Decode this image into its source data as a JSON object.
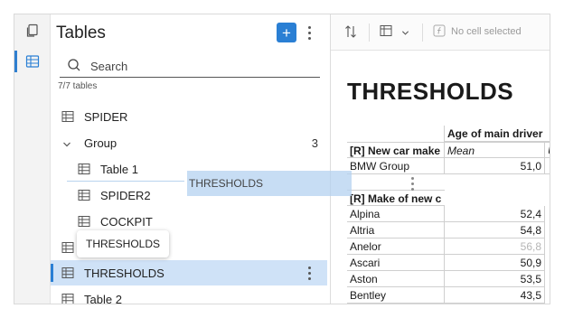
{
  "panel": {
    "title": "Tables",
    "search_placeholder": "Search",
    "count_label": "7/7 tables"
  },
  "tree": {
    "items": [
      {
        "label": "SPIDER"
      },
      {
        "label": "Group",
        "count": "3"
      },
      {
        "label": "Table 1"
      },
      {
        "label": "SPIDER2"
      },
      {
        "label": "COCKPIT"
      },
      {
        "label": "THRESHOLDS"
      },
      {
        "label": "Table 2"
      }
    ]
  },
  "drag": {
    "ghost_label": "THRESHOLDS",
    "tooltip": "THRESHOLDS"
  },
  "toolbar": {
    "no_cell": "No cell selected"
  },
  "report": {
    "title": "THRESHOLDS",
    "col_header": "Age of main driver",
    "section1_label": "[R] New car make",
    "mean_label": "Mean",
    "second_col_partial": "U",
    "bmw_label": "BMW Group",
    "bmw_value": "51,0",
    "section2_label": "[R] Make of new c",
    "rows": [
      {
        "label": "Alpina",
        "value": "52,4"
      },
      {
        "label": "Altria",
        "value": "54,8"
      },
      {
        "label": "Anelor",
        "value": "56,8"
      },
      {
        "label": "Ascari",
        "value": "50,9"
      },
      {
        "label": "Aston",
        "value": "53,5"
      },
      {
        "label": "Bentley",
        "value": "43,5"
      }
    ],
    "muted_color": "#b5b5b5"
  },
  "colors": {
    "accent": "#2a7fd4",
    "selection": "#cfe2f7"
  }
}
